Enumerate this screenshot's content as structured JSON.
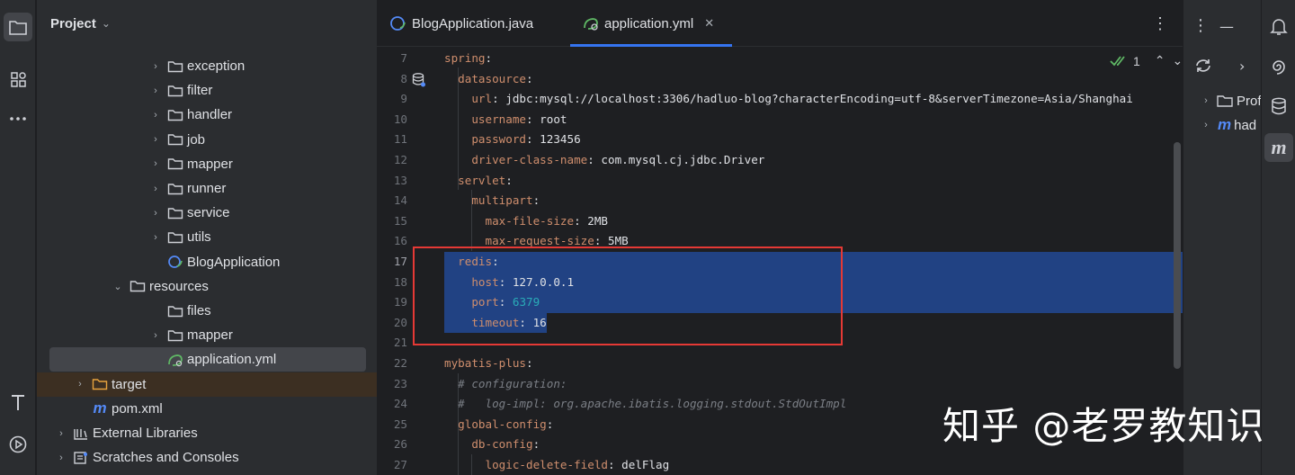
{
  "project_panel": {
    "title": "Project",
    "tree": [
      {
        "label": "exception",
        "kind": "folder",
        "level": 3,
        "expanded": false
      },
      {
        "label": "filter",
        "kind": "folder",
        "level": 3,
        "expanded": false
      },
      {
        "label": "handler",
        "kind": "folder",
        "level": 3,
        "expanded": false
      },
      {
        "label": "job",
        "kind": "folder",
        "level": 3,
        "expanded": false
      },
      {
        "label": "mapper",
        "kind": "folder",
        "level": 3,
        "expanded": false
      },
      {
        "label": "runner",
        "kind": "folder",
        "level": 3,
        "expanded": false
      },
      {
        "label": "service",
        "kind": "folder",
        "level": 3,
        "expanded": false
      },
      {
        "label": "utils",
        "kind": "folder",
        "level": 3,
        "expanded": false
      },
      {
        "label": "BlogApplication",
        "kind": "spring-class",
        "level": 3,
        "expanded": null
      },
      {
        "label": "resources",
        "kind": "resources-folder",
        "level": 2,
        "expanded": true
      },
      {
        "label": "files",
        "kind": "folder",
        "level": 3,
        "expanded": null
      },
      {
        "label": "mapper",
        "kind": "folder",
        "level": 3,
        "expanded": false
      },
      {
        "label": "application.yml",
        "kind": "yml-file",
        "level": 3,
        "expanded": null,
        "selected": true
      },
      {
        "label": "target",
        "kind": "excluded-folder",
        "level": 1,
        "expanded": false
      },
      {
        "label": "pom.xml",
        "kind": "maven-file",
        "level": 1,
        "expanded": null
      },
      {
        "label": "External Libraries",
        "kind": "libraries",
        "level": 0,
        "expanded": false
      },
      {
        "label": "Scratches and Consoles",
        "kind": "scratches",
        "level": 0,
        "expanded": false
      }
    ]
  },
  "tabs": [
    {
      "label": "BlogApplication.java",
      "active": false
    },
    {
      "label": "application.yml",
      "active": true
    }
  ],
  "editor": {
    "inspection_count": "1",
    "lines": [
      {
        "n": "7",
        "tokens": [
          [
            "k",
            "spring"
          ],
          [
            "v",
            ":"
          ]
        ]
      },
      {
        "n": "8",
        "tokens": [
          [
            "v",
            "  "
          ],
          [
            "k",
            "datasource"
          ],
          [
            "v",
            ":"
          ]
        ]
      },
      {
        "n": "9",
        "tokens": [
          [
            "v",
            "    "
          ],
          [
            "k",
            "url"
          ],
          [
            "v",
            ": jdbc:mysql://localhost:3306/hadluo-blog?characterEncoding=utf-8&serverTimezone=Asia/Shanghai"
          ]
        ]
      },
      {
        "n": "10",
        "tokens": [
          [
            "v",
            "    "
          ],
          [
            "k",
            "username"
          ],
          [
            "v",
            ": root"
          ]
        ]
      },
      {
        "n": "11",
        "tokens": [
          [
            "v",
            "    "
          ],
          [
            "k",
            "password"
          ],
          [
            "v",
            ": 123456"
          ]
        ]
      },
      {
        "n": "12",
        "tokens": [
          [
            "v",
            "    "
          ],
          [
            "k",
            "driver-class-name"
          ],
          [
            "v",
            ": com.mysql.cj.jdbc.Driver"
          ]
        ]
      },
      {
        "n": "13",
        "tokens": [
          [
            "v",
            "  "
          ],
          [
            "k",
            "servlet"
          ],
          [
            "v",
            ":"
          ]
        ]
      },
      {
        "n": "14",
        "tokens": [
          [
            "v",
            "    "
          ],
          [
            "k",
            "multipart"
          ],
          [
            "v",
            ":"
          ]
        ]
      },
      {
        "n": "15",
        "tokens": [
          [
            "v",
            "      "
          ],
          [
            "k",
            "max-file-size"
          ],
          [
            "v",
            ": 2MB"
          ]
        ]
      },
      {
        "n": "16",
        "tokens": [
          [
            "v",
            "      "
          ],
          [
            "k",
            "max-request-size"
          ],
          [
            "v",
            ": 5MB"
          ]
        ]
      },
      {
        "n": "17",
        "tokens": [
          [
            "v",
            "  "
          ],
          [
            "k",
            "redis"
          ],
          [
            "v",
            ":"
          ]
        ]
      },
      {
        "n": "18",
        "tokens": [
          [
            "v",
            "    "
          ],
          [
            "k",
            "host"
          ],
          [
            "v",
            ": 127.0.0.1"
          ]
        ]
      },
      {
        "n": "19",
        "tokens": [
          [
            "v",
            "    "
          ],
          [
            "k",
            "port"
          ],
          [
            "v",
            ": "
          ],
          [
            "n",
            "6379"
          ]
        ]
      },
      {
        "n": "20",
        "tokens": [
          [
            "v",
            "    "
          ],
          [
            "k",
            "timeout"
          ],
          [
            "v",
            ": 16"
          ]
        ]
      },
      {
        "n": "21",
        "tokens": []
      },
      {
        "n": "22",
        "tokens": [
          [
            "k",
            "mybatis-plus"
          ],
          [
            "v",
            ":"
          ]
        ]
      },
      {
        "n": "23",
        "tokens": [
          [
            "v",
            "  "
          ],
          [
            "c",
            "# configuration:"
          ]
        ]
      },
      {
        "n": "24",
        "tokens": [
          [
            "v",
            "  "
          ],
          [
            "c",
            "#   log-impl: org.apache.ibatis.logging.stdout.StdOutImpl"
          ]
        ]
      },
      {
        "n": "25",
        "tokens": [
          [
            "v",
            "  "
          ],
          [
            "k",
            "global-config"
          ],
          [
            "v",
            ":"
          ]
        ]
      },
      {
        "n": "26",
        "tokens": [
          [
            "v",
            "    "
          ],
          [
            "k",
            "db-config"
          ],
          [
            "v",
            ":"
          ]
        ]
      },
      {
        "n": "27",
        "tokens": [
          [
            "v",
            "      "
          ],
          [
            "k",
            "logic-delete-field"
          ],
          [
            "v",
            ": delFlag"
          ]
        ]
      }
    ]
  },
  "right_panel": {
    "items": [
      {
        "label": "Prof",
        "icon": "folder-icon"
      },
      {
        "label": "had",
        "icon": "maven-icon"
      }
    ]
  },
  "watermark": "知乎 @老罗教知识",
  "colors": {
    "accent": "#3574f0",
    "selection": "#214283",
    "keyword": "#cf8e6d",
    "number": "#2aacb8",
    "highlight_box": "#e53935"
  }
}
